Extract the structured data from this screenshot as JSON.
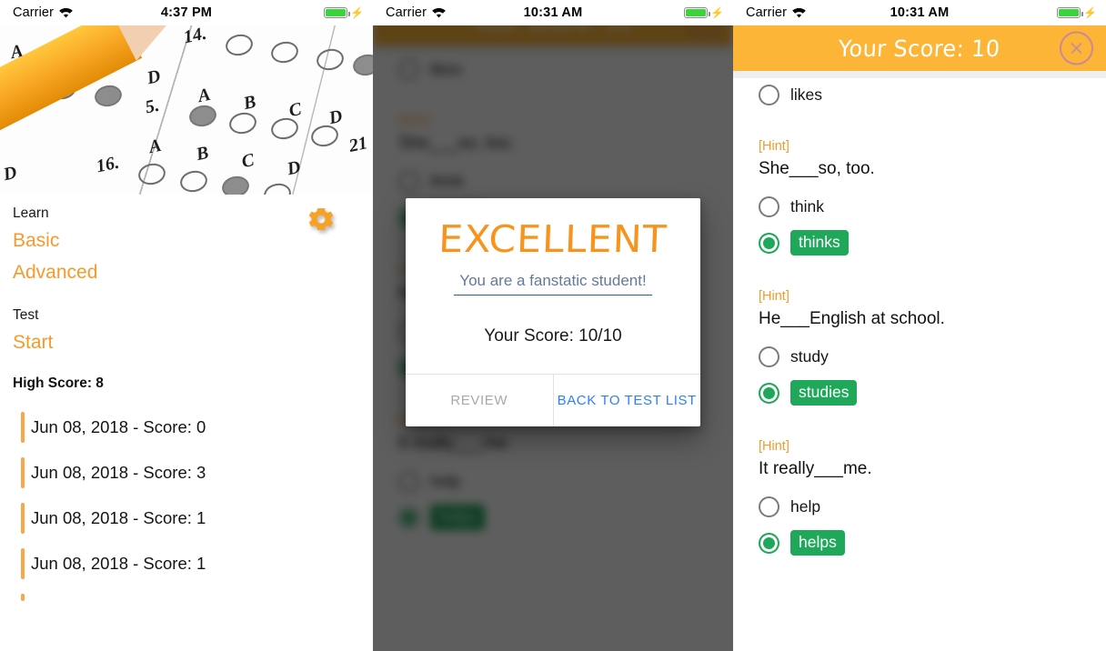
{
  "app": {
    "accent_orange": "#f79a2b",
    "nav_orange": "#fcb537",
    "correct_green": "#1fa85a",
    "link_blue": "#2d7ff9"
  },
  "panel_home": {
    "status_bar": {
      "carrier": "Carrier",
      "time": "4:37 PM",
      "wifi_icon": "wifi-icon",
      "battery_icon": "battery-icon",
      "charging_icon": "charging-bolt-icon"
    },
    "hero_image_alt": "scantron-answer-sheet-with-pencil",
    "settings_icon": "gear-icon",
    "learn": {
      "heading": "Learn",
      "items": [
        {
          "label": "Basic"
        },
        {
          "label": "Advanced"
        }
      ]
    },
    "test": {
      "heading": "Test",
      "items": [
        {
          "label": "Start"
        }
      ]
    },
    "high_score_label": "High Score: 8",
    "score_history": [
      {
        "text": "Jun 08, 2018 - Score: 0"
      },
      {
        "text": "Jun 08, 2018 - Score: 3"
      },
      {
        "text": "Jun 08, 2018 - Score: 1"
      },
      {
        "text": "Jun 08, 2018 - Score: 1"
      }
    ]
  },
  "panel_dialog": {
    "status_bar": {
      "carrier": "Carrier",
      "time": "10:31 AM",
      "wifi_icon": "wifi-icon",
      "battery_icon": "battery-icon",
      "charging_icon": "charging-bolt-icon"
    },
    "dialog": {
      "title": "EXCELLENT",
      "subtitle": "You are a fanstatic student!",
      "score": "Your Score: 10/10",
      "review_button": "REVIEW",
      "back_button": "BACK TO TEST LIST"
    }
  },
  "panel_results": {
    "status_bar": {
      "carrier": "Carrier",
      "time": "10:31 AM",
      "wifi_icon": "wifi-icon",
      "battery_icon": "battery-icon",
      "charging_icon": "charging-bolt-icon"
    },
    "navbar": {
      "title": "Your Score: 10",
      "close_icon": "close-x-icon"
    },
    "leading_option": {
      "label": "likes"
    },
    "questions": [
      {
        "hint": "[Hint]",
        "text": "She___so, too.",
        "options": [
          {
            "label": "think",
            "correct": false
          },
          {
            "label": "thinks",
            "correct": true
          }
        ]
      },
      {
        "hint": "[Hint]",
        "text": "He___English at school.",
        "options": [
          {
            "label": "study",
            "correct": false
          },
          {
            "label": "studies",
            "correct": true
          }
        ]
      },
      {
        "hint": "[Hint]",
        "text": "It really___me.",
        "options": [
          {
            "label": "help",
            "correct": false
          },
          {
            "label": "helps",
            "correct": true
          }
        ]
      }
    ]
  }
}
